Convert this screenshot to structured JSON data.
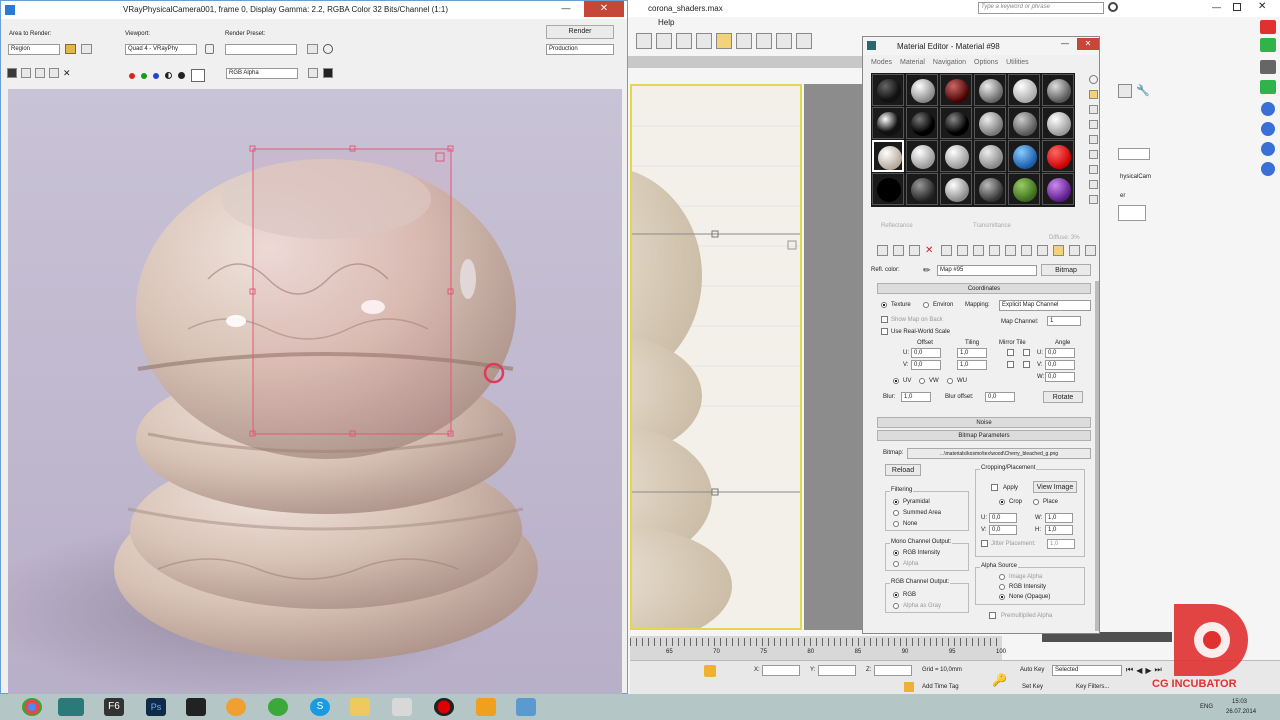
{
  "vfb": {
    "title": "VRayPhysicalCamera001, frame 0, Display Gamma: 2.2, RGBA Color 32 Bits/Channel (1:1)",
    "area_label": "Area to Render:",
    "area_value": "Region",
    "viewport_label": "Viewport:",
    "viewport_value": "Quad 4 - VRayPhy",
    "preset_label": "Render Preset:",
    "preset_value": "",
    "render_button": "Render",
    "render_mode": "Production",
    "channel_value": "RGB Alpha"
  },
  "max": {
    "title": "corona_shaders.max",
    "menu_help": "Help",
    "search_placeholder": "Type a keyword or phrase",
    "timeline_ticks": [
      "65",
      "70",
      "75",
      "80",
      "85",
      "90",
      "95",
      "100"
    ],
    "grid_label": "Grid = 10,0mm",
    "add_time_tag": "Add Time Tag",
    "auto_key": "Auto Key",
    "selected": "Selected",
    "set_key": "Set Key",
    "key_filters": "Key Filters...",
    "coord_x": "X:",
    "coord_y": "Y:",
    "coord_z": "Z:",
    "right_panel_text1": "hysicalCam",
    "right_panel_text2": "er"
  },
  "material_editor": {
    "title": "Material Editor - Material #98",
    "menus": [
      "Modes",
      "Material",
      "Navigation",
      "Options",
      "Utilities"
    ],
    "refl_color_label": "Refl. color:",
    "map_name": "Map #95",
    "map_type": "Bitmap",
    "ghost_reflectance": "Reflectance",
    "ghost_transmittance": "Transmittance",
    "ghost_diffuse": "Diffuse: 3%",
    "coordinates": {
      "header": "Coordinates",
      "texture": "Texture",
      "environ": "Environ",
      "mapping_label": "Mapping:",
      "mapping_value": "Explicit Map Channel",
      "show_map_back": "Show Map on Back",
      "map_channel_label": "Map Channel:",
      "map_channel_value": "1",
      "use_real_world": "Use Real-World Scale",
      "offset": "Offset",
      "tiling": "Tiling",
      "mirror_tile": "Mirror Tile",
      "angle": "Angle",
      "u": "U:",
      "v": "V:",
      "w": "W:",
      "offset_u": "0,0",
      "offset_v": "0,0",
      "tiling_u": "1,0",
      "tiling_v": "1,0",
      "angle_u": "0,0",
      "angle_v": "0,0",
      "angle_w": "0,0",
      "uv": "UV",
      "vw": "VW",
      "wu": "WU",
      "blur_label": "Blur:",
      "blur_value": "1,0",
      "blur_offset_label": "Blur offset:",
      "blur_offset_value": "0,0",
      "rotate": "Rotate"
    },
    "noise": {
      "header": "Noise"
    },
    "bitmap": {
      "header": "Bitmap Parameters",
      "bitmap_label": "Bitmap:",
      "bitmap_path": "...\\materials\\kosmo\\tex\\wood\\Cherry_bleached_g.png",
      "reload": "Reload",
      "cropping_title": "Cropping/Placement",
      "apply": "Apply",
      "view_image": "View Image",
      "crop": "Crop",
      "place": "Place",
      "u": "U:",
      "v": "V:",
      "w": "W:",
      "h": "H:",
      "crop_u": "0,0",
      "crop_v": "0,0",
      "crop_w": "1,0",
      "crop_h": "1,0",
      "jitter_placement": "Jitter Placement:",
      "jitter_value": "1,0",
      "filtering_title": "Filtering",
      "pyramidal": "Pyramidal",
      "summed_area": "Summed Area",
      "none": "None",
      "mono_title": "Mono Channel Output:",
      "rgb_intensity": "RGB Intensity",
      "alpha": "Alpha",
      "rgb_out_title": "RGB Channel Output:",
      "rgb": "RGB",
      "alpha_as_gray": "Alpha as Gray",
      "alpha_source_title": "Alpha Source",
      "image_alpha": "Image Alpha",
      "alpha_rgb_intensity": "RGB Intensity",
      "none_opaque": "None (Opaque)",
      "premultiplied": "Premultiplied Alpha"
    }
  },
  "status": {
    "time": "15:03",
    "date": "26.07.2014",
    "lang": "ENG",
    "watermark": "CG INCUBATOR"
  },
  "colors": {
    "accent": "#e03030",
    "viewport_border": "#e6d64a",
    "title_blue": "#6a9ed6"
  }
}
